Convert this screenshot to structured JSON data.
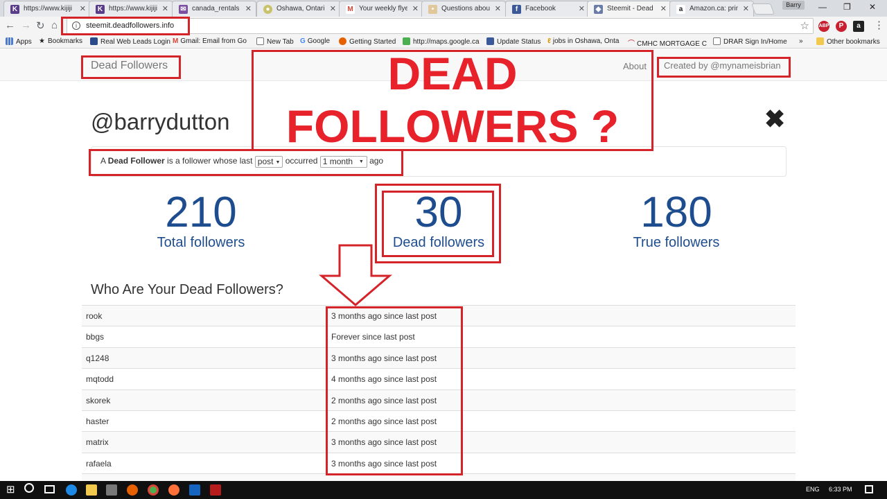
{
  "browser": {
    "tabs": [
      {
        "label": "https://www.kijiji",
        "color": "#5a3d8a",
        "glyph": "K"
      },
      {
        "label": "https://www.kijiji",
        "color": "#5a3d8a",
        "glyph": "K"
      },
      {
        "label": "canada_rentals -",
        "color": "#7b4fa0",
        "glyph": "✉"
      },
      {
        "label": "Oshawa, Ontario",
        "color": "#c8c36a",
        "glyph": "●"
      },
      {
        "label": "Your weekly flyer",
        "color": "#d44638",
        "glyph": "M"
      },
      {
        "label": "Questions about",
        "color": "#e0c89a",
        "glyph": "•"
      },
      {
        "label": "Facebook",
        "color": "#3b5998",
        "glyph": "f"
      },
      {
        "label": "Steemit - Dead F",
        "color": "#6a7ca8",
        "glyph": "◆"
      },
      {
        "label": "Amazon.ca: prin",
        "color": "#222222",
        "glyph": "a"
      }
    ],
    "profile": "Barry",
    "url": "steemit.deadfollowers.info",
    "bookmarks": [
      "Apps",
      "Bookmarks",
      "Real Web Leads Login",
      "Gmail: Email from Go",
      "New Tab",
      "Google",
      "Getting Started",
      "http://maps.google.ca",
      "Update Status",
      "jobs in Oshawa, Onta",
      "CMHC MORTGAGE C",
      "DRAR Sign In/Home",
      "»",
      "Other bookmarks"
    ],
    "extensions": [
      "ABP",
      "P",
      "a"
    ]
  },
  "page": {
    "brand": "Dead Followers",
    "about": "About",
    "created_by": "Created by @mynameisbrian",
    "username": "@barrydutton",
    "close_glyph": "✖",
    "definition": {
      "prefix": "A ",
      "term": "Dead Follower",
      "middle": " is a follower whose last ",
      "activity_select": "post",
      "occurred": " occurred ",
      "period_select": "1 month",
      "suffix": " ago"
    },
    "stats": [
      {
        "value": "210",
        "label": "Total followers"
      },
      {
        "value": "30",
        "label": "Dead followers"
      },
      {
        "value": "180",
        "label": "True followers"
      }
    ],
    "section_title": "Who Are Your Dead Followers?",
    "dead_followers": [
      {
        "name": "rook",
        "since": "3 months ago since last post"
      },
      {
        "name": "bbgs",
        "since": "Forever since last post"
      },
      {
        "name": "q1248",
        "since": "3 months ago since last post"
      },
      {
        "name": "mqtodd",
        "since": "4 months ago since last post"
      },
      {
        "name": "skorek",
        "since": "2 months ago since last post"
      },
      {
        "name": "haster",
        "since": "2 months ago since last post"
      },
      {
        "name": "matrix",
        "since": "3 months ago since last post"
      },
      {
        "name": "rafaela",
        "since": "3 months ago since last post"
      }
    ]
  },
  "annotation": {
    "line1": "DEAD",
    "line2": "FOLLOWERS ?",
    "color": "#e8222a"
  },
  "taskbar": {
    "lang": "ENG",
    "time": "6:33 PM"
  }
}
